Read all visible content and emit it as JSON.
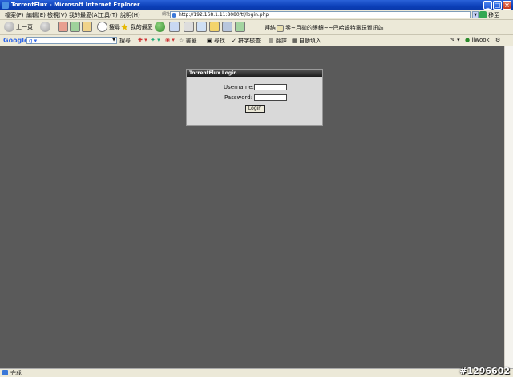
{
  "window": {
    "title": "TorrentFlux - Microsoft Internet Explorer"
  },
  "menu": [
    "檔案(F)",
    "編輯(E)",
    "檢視(V)",
    "我的最愛(A)",
    "工具(T)",
    "說明(H)"
  ],
  "address": {
    "label": "網址(D)",
    "url": "http://192.168.1.11:8080/tf/login.php",
    "go_label": "移至"
  },
  "toolbar": {
    "back_label": "上一頁",
    "search_label": "搜尋",
    "favorites_label": "我的最愛",
    "links_label": "連結",
    "links_text": "零~月拋的眼鏡~~巴哈姆特電玩資訊站"
  },
  "googlebar": {
    "logo": "Google",
    "search_label": "搜尋",
    "bookmarks_label": "書籤",
    "find_label": "尋找",
    "spell_label": "拼字檢查",
    "translate_label": "翻譯",
    "autofill_label": "自動填入",
    "user_label": "llwook"
  },
  "login": {
    "title": "TorrentFlux Login",
    "username_label": "Username:",
    "password_label": "Password:",
    "button_label": "Login"
  },
  "status": {
    "text": "完成"
  },
  "watermark": "#1296602"
}
